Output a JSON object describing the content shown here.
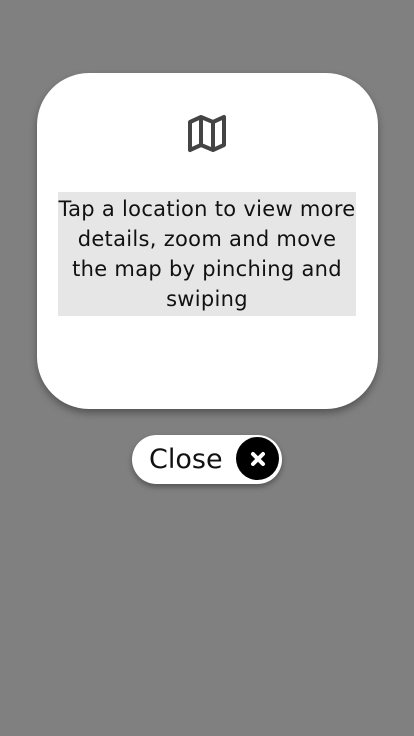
{
  "dialog": {
    "icon": "map-icon",
    "message": "Tap a location to view more details, zoom and move the map by pinching and swiping"
  },
  "close_button": {
    "label": "Close",
    "icon": "close-icon"
  },
  "colors": {
    "overlay": "#808080",
    "card": "#ffffff",
    "text_box": "#e6e6e6",
    "icon_dark": "#444444",
    "close_circle": "#000000"
  }
}
